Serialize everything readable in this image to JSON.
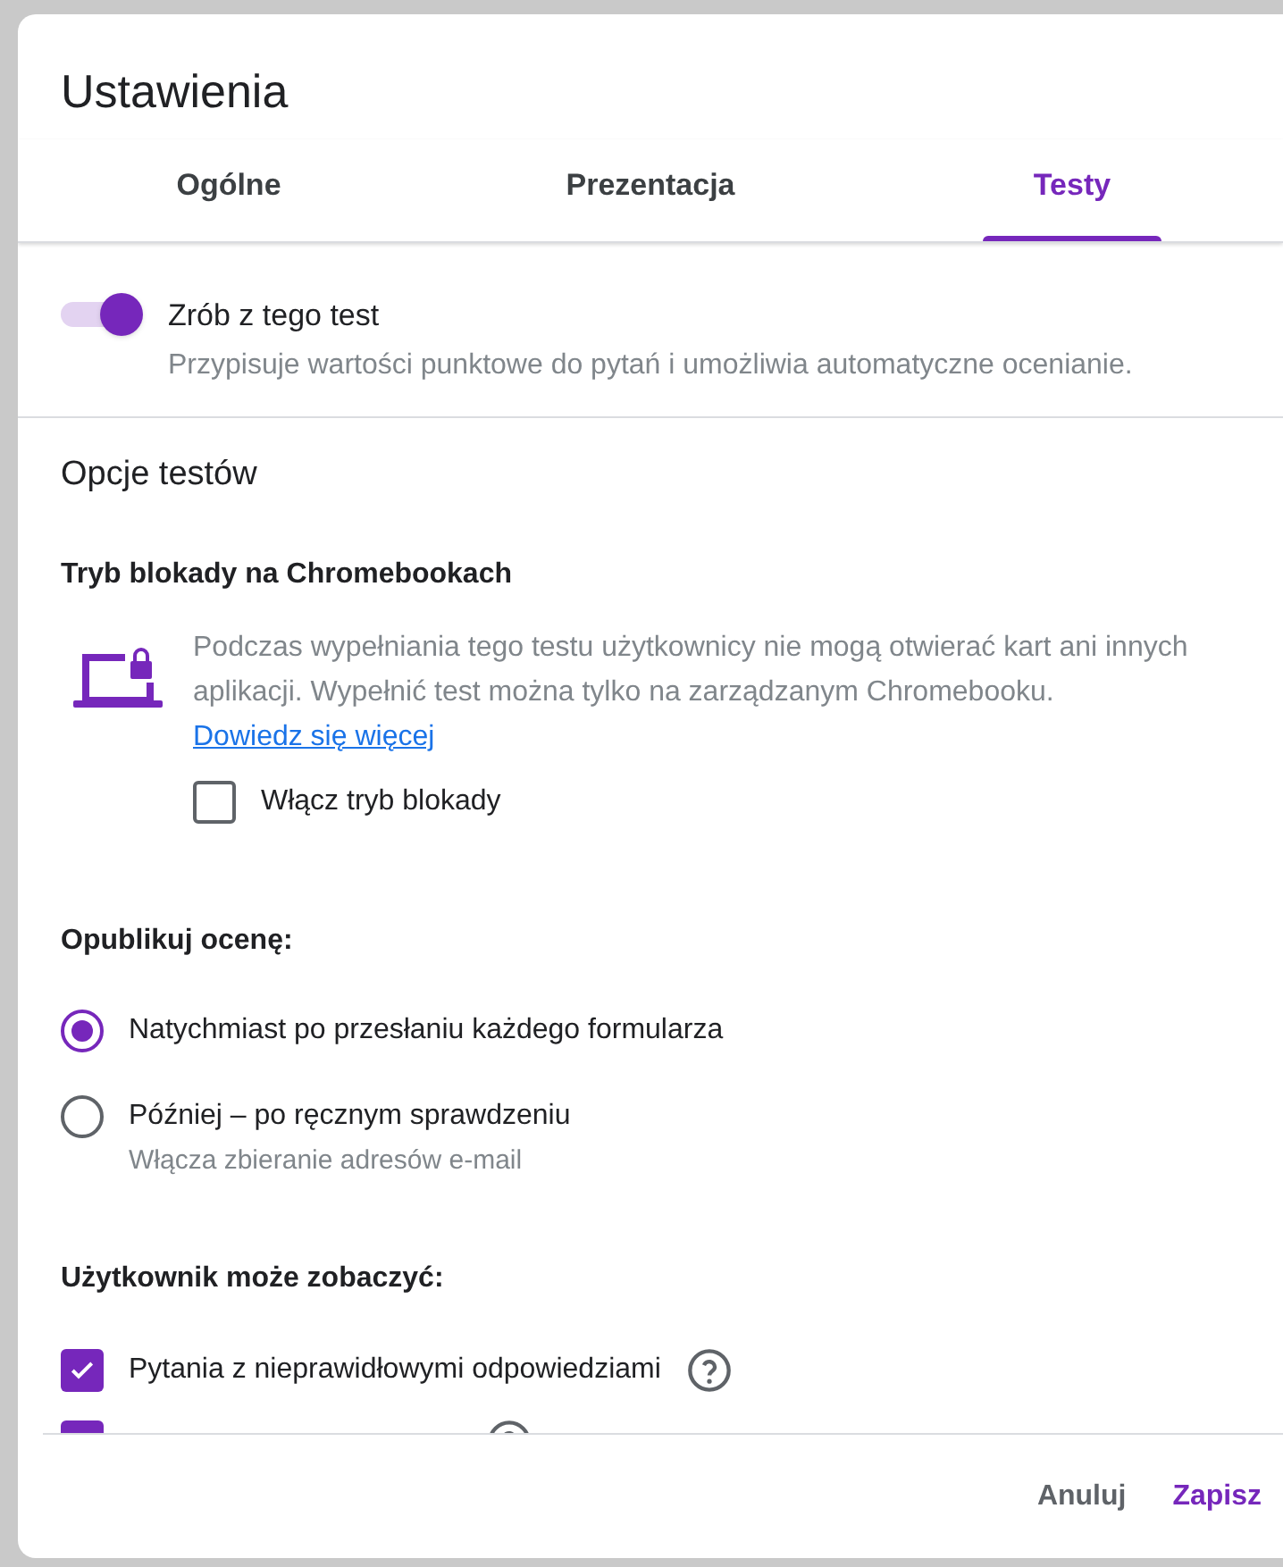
{
  "dialog": {
    "title": "Ustawienia"
  },
  "tabs": [
    {
      "label": "Ogólne",
      "selected": false
    },
    {
      "label": "Prezentacja",
      "selected": false
    },
    {
      "label": "Testy",
      "selected": true
    }
  ],
  "quiz_toggle": {
    "label": "Zrób z tego test",
    "description": "Przypisuje wartości punktowe do pytań i umożliwia automatyczne ocenianie.",
    "on": true
  },
  "section_title": "Opcje testów",
  "lockdown": {
    "heading": "Tryb blokady na Chromebookach",
    "description": "Podczas wypełniania tego testu użytkownicy nie mogą otwierać kart ani innych aplikacji. Wypełnić test można tylko na zarządzanym Chromebooku.",
    "link": "Dowiedz się więcej",
    "checkbox": {
      "label": "Włącz tryb blokady",
      "checked": false
    }
  },
  "release_grade": {
    "heading": "Opublikuj ocenę:",
    "options": [
      {
        "label": "Natychmiast po przesłaniu każdego formularza",
        "selected": true
      },
      {
        "label": "Później – po ręcznym sprawdzeniu",
        "hint": "Włącza zbieranie adresów e-mail",
        "selected": false
      }
    ]
  },
  "respondent_can_see": {
    "heading": "Użytkownik może zobaczyć:",
    "items": [
      {
        "label": "Pytania z nieprawidłowymi odpowiedziami",
        "checked": true,
        "help": true
      },
      {
        "checked": true,
        "help": true
      }
    ]
  },
  "buttons": [
    {
      "label": "Anuluj",
      "kind": "secondary"
    },
    {
      "label": "Zapisz",
      "kind": "primary"
    }
  ]
}
